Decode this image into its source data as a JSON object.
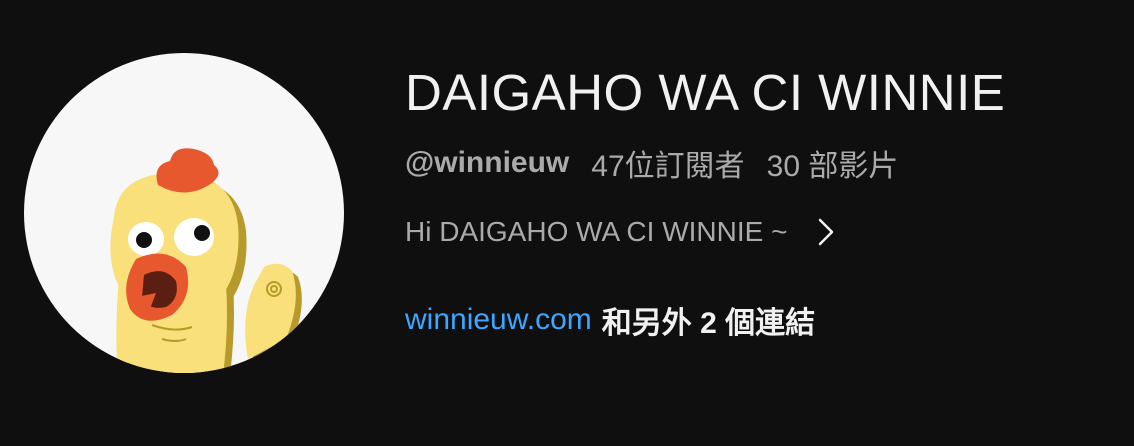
{
  "channel": {
    "title": "DAIGAHO WA CI WINNIE",
    "handle": "@winnieuw",
    "subscribers": "47位訂閱者",
    "videos": "30 部影片",
    "description": "Hi DAIGAHO WA CI WINNIE ~",
    "link_url": "winnieuw.com",
    "link_more": "和另外 2 個連結"
  },
  "avatar": {
    "icon": "chicken-avatar-icon"
  },
  "colors": {
    "background": "#0f0f0f",
    "title": "#f1f1f1",
    "secondary_text": "#aaaaaa",
    "link": "#3ea6ff",
    "avatar_bg": "#f7f7f8",
    "chicken_yellow": "#f9e07a",
    "chicken_shadow": "#b89a2c",
    "comb_red": "#e8582e"
  }
}
